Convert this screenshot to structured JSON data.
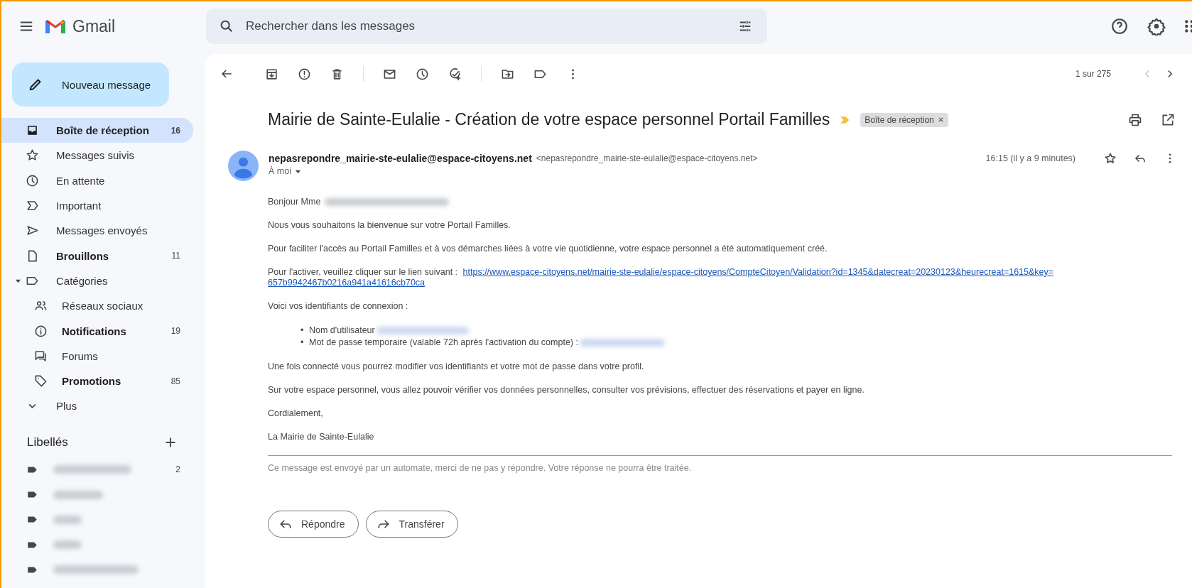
{
  "app": {
    "name": "Gmail"
  },
  "search": {
    "placeholder": "Rechercher dans les messages"
  },
  "compose": {
    "label": "Nouveau message"
  },
  "sidebar": {
    "items": [
      {
        "label": "Boîte de réception",
        "count": "16",
        "selected": true,
        "unread": true
      },
      {
        "label": "Messages suivis",
        "selected": false,
        "unread": false
      },
      {
        "label": "En attente",
        "selected": false,
        "unread": false
      },
      {
        "label": "Important",
        "selected": false,
        "unread": false
      },
      {
        "label": "Messages envoyés",
        "selected": false,
        "unread": false
      },
      {
        "label": "Brouillons",
        "count": "11",
        "selected": false,
        "unread": true
      },
      {
        "label": "Catégories",
        "selected": false,
        "unread": false,
        "expanded": true,
        "children": [
          {
            "label": "Réseaux sociaux",
            "selected": false,
            "unread": false
          },
          {
            "label": "Notifications",
            "count": "19",
            "selected": false,
            "unread": true
          },
          {
            "label": "Forums",
            "selected": false,
            "unread": false
          },
          {
            "label": "Promotions",
            "count": "85",
            "selected": false,
            "unread": true
          }
        ]
      },
      {
        "label": "Plus",
        "selected": false,
        "unread": false
      }
    ]
  },
  "labels": {
    "title": "Libellés",
    "items": [
      {
        "count": "2",
        "redacted": true
      },
      {
        "redacted": true
      },
      {
        "redacted": true
      },
      {
        "redacted": true
      },
      {
        "redacted": true
      }
    ]
  },
  "toolbar": {
    "pagination": "1 sur 275",
    "prev_disabled": true
  },
  "message": {
    "subject": "Mairie de Sainte-Eulalie - Création de votre espace personnel Portail Familles",
    "important": true,
    "tag": "Boîte de réception",
    "sender_name": "nepasrepondre_mairie-ste-eulalie@espace-citoyens.net",
    "sender_address": "<nepasrepondre_mairie-ste-eulalie@espace-citoyens.net>",
    "recipient": "À moi",
    "time": "16:15 (il y a 9 minutes)",
    "starred": false,
    "body": [
      {
        "kind": "text",
        "text": "Bonjour Mme",
        "redacted": true
      },
      {
        "kind": "text",
        "text": "Nous vous souhaitons la bienvenue sur votre Portail Familles."
      },
      {
        "kind": "text",
        "text": "Pour faciliter l'accès au Portail Familles et à vos démarches liées à votre vie quotidienne, votre espace personnel a été automatiquement créé."
      },
      {
        "kind": "link",
        "text": "Pour l'activer, veuillez cliquer sur le lien suivant :",
        "link_lines": [
          "https://www.espace-citoyens.net/mairie-ste-eulalie/espace-citoyens/CompteCitoyen/Validation?id=1345&datecreat=20230123&heurecreat=1615&key=",
          "657b9942467b0216a941a41616cb70ca"
        ]
      },
      {
        "kind": "text",
        "text": "Voici vos identifiants de connexion :"
      },
      {
        "kind": "list",
        "marker": "•",
        "items": [
          "Nom d'utilisateur",
          "Mot de passe temporaire (valable 72h après l'activation du compte) :"
        ]
      },
      {
        "kind": "text",
        "text": "Une fois connecté vous pourrez modifier vos identifiants et votre mot de passe dans votre profil."
      },
      {
        "kind": "text",
        "text": "Sur votre espace personnel, vous allez pouvoir vérifier vos données personnelles, consulter vos prévisions, effectuer des réservations et payer en ligne."
      },
      {
        "kind": "text",
        "text": "Cordialement,"
      },
      {
        "kind": "text",
        "text": "La Mairie de Sainte-Eulalie"
      }
    ],
    "footer": "Ce message est envoyé par un automate, merci de ne pas y répondre. Votre réponse ne pourra être traitée.",
    "actions": [
      "Répondre",
      "Transférer"
    ]
  }
}
